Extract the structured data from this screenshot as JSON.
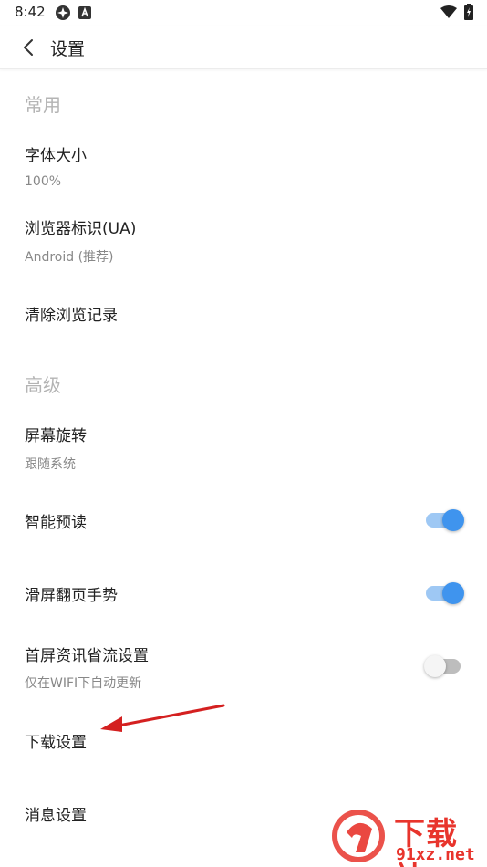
{
  "status_bar": {
    "time": "8:42",
    "icons": [
      "app-notification-icon",
      "a-notification-icon",
      "wifi-icon",
      "battery-icon"
    ]
  },
  "app_bar": {
    "title": "设置",
    "back_icon": "chevron-left-icon"
  },
  "sections": [
    {
      "header": "常用",
      "items": [
        {
          "title": "字体大小",
          "subtitle": "100%"
        },
        {
          "title": "浏览器标识(UA)",
          "subtitle": "Android (推荐)"
        },
        {
          "title": "清除浏览记录"
        }
      ]
    },
    {
      "header": "高级",
      "items": [
        {
          "title": "屏幕旋转",
          "subtitle": "跟随系统"
        },
        {
          "title": "智能预读",
          "toggle": true
        },
        {
          "title": "滑屏翻页手势",
          "toggle": true
        },
        {
          "title": "首屏资讯省流设置",
          "subtitle": "仅在WIFI下自动更新",
          "toggle": false
        },
        {
          "title": "下载设置"
        },
        {
          "title": "消息设置"
        }
      ]
    }
  ],
  "colors": {
    "toggle_on_thumb": "#3f94ee",
    "toggle_on_track": "#9ec8f4",
    "toggle_off_thumb": "#f5f5f5",
    "toggle_off_track": "#bdbdbd",
    "section_header": "#b4b4b4",
    "annotation_arrow": "#d42020",
    "watermark": "#e8342c"
  },
  "watermark": {
    "brand_top": "下载站",
    "brand_bottom": "91xz.net"
  }
}
